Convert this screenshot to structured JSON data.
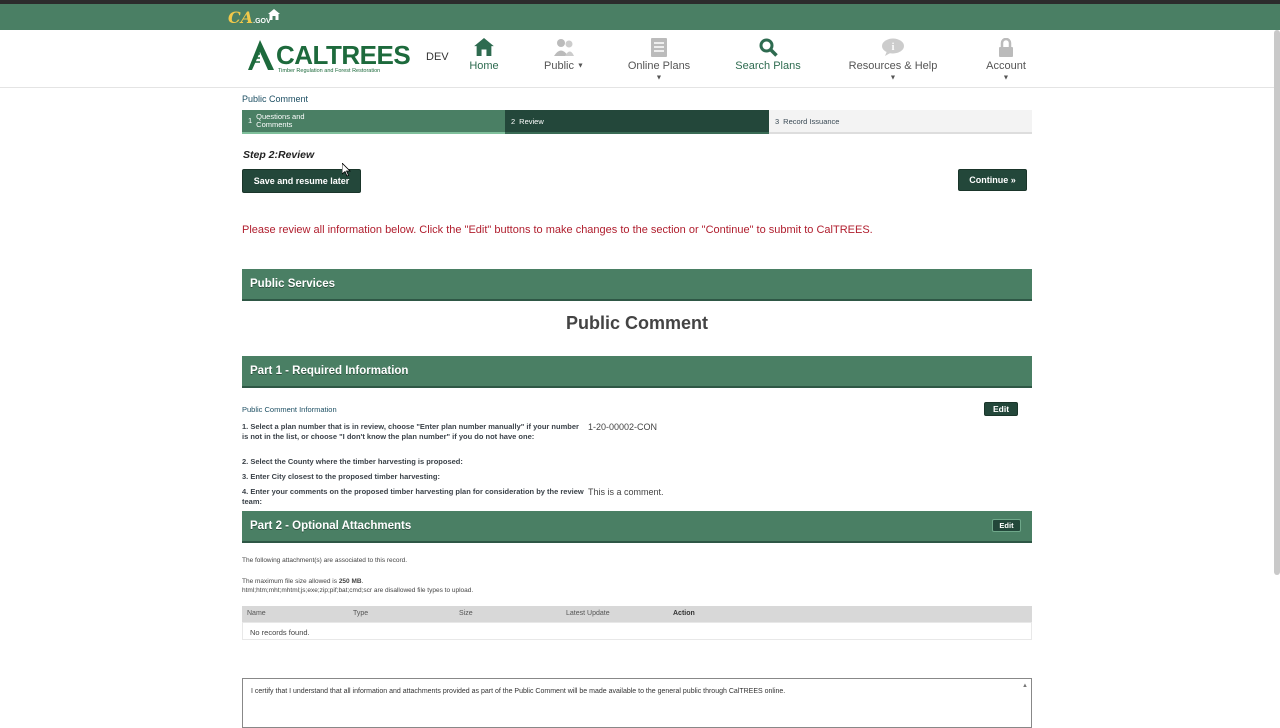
{
  "topbar": {
    "ca_logo": "CA",
    "ca_logo_sub": ".GOV",
    "home_icon": "home-icon"
  },
  "header": {
    "brand": "CALTREES",
    "brand_sub": "Timber Regulation and Forest Restoration",
    "env": "DEV",
    "nav": [
      {
        "label": "Home",
        "icon": "home-icon"
      },
      {
        "label": "Public",
        "icon": "users-icon",
        "dropdown": true
      },
      {
        "label": "Online Plans",
        "icon": "document-icon",
        "dropdown": true
      },
      {
        "label": "Search Plans",
        "icon": "search-icon"
      },
      {
        "label": "Resources & Help",
        "icon": "info-icon",
        "dropdown": true
      },
      {
        "label": "Account",
        "icon": "lock-icon",
        "dropdown": true
      }
    ]
  },
  "breadcrumb": "Public Comment",
  "steps": [
    {
      "num": "1",
      "label": "Questions and Comments"
    },
    {
      "num": "2",
      "label": "Review"
    },
    {
      "num": "3",
      "label": "Record Issuance"
    }
  ],
  "step_title": "Step 2:Review",
  "save_label": "Save and resume later",
  "continue_label": "Continue »",
  "review_message": "Please review all information below. Click the \"Edit\" buttons to make changes to the section or \"Continue\" to submit to CalTREES.",
  "public_services": "Public Services",
  "form_title": "Public Comment",
  "part1": {
    "title": "Part 1 - Required Information",
    "section_label": "Public Comment Information",
    "edit_label": "Edit",
    "questions": [
      {
        "q": "1. Select a plan number that is in review, choose \"Enter plan number manually\" if your number is not in the list, or choose \"I don't know the plan number\" if you do not have one:",
        "a": "1-20-00002-CON"
      },
      {
        "q": "2. Select the County where the timber harvesting is proposed:",
        "a": ""
      },
      {
        "q": "3. Enter City closest to the proposed timber harvesting:",
        "a": ""
      },
      {
        "q": "4. Enter your comments on the proposed timber harvesting plan for consideration by the review team:",
        "a": "This is a comment."
      }
    ]
  },
  "part2": {
    "title": "Part 2 - Optional Attachments",
    "edit_label": "Edit",
    "assoc_text": "The following attachment(s) are associated to this record.",
    "max_size_prefix": "The maximum file size allowed is ",
    "max_size_value": "250 MB",
    "max_size_suffix": ".",
    "disallowed": "html;htm;mht;mhtml;js;exe;zip;pif;bat;cmd;scr are disallowed file types to upload.",
    "columns": [
      "Name",
      "Type",
      "Size",
      "Latest Update",
      "Action"
    ],
    "empty": "No records found."
  },
  "certification": "I certify that I understand that all information and attachments provided as part of the Public Comment will be made available to the general public through CalTREES online."
}
